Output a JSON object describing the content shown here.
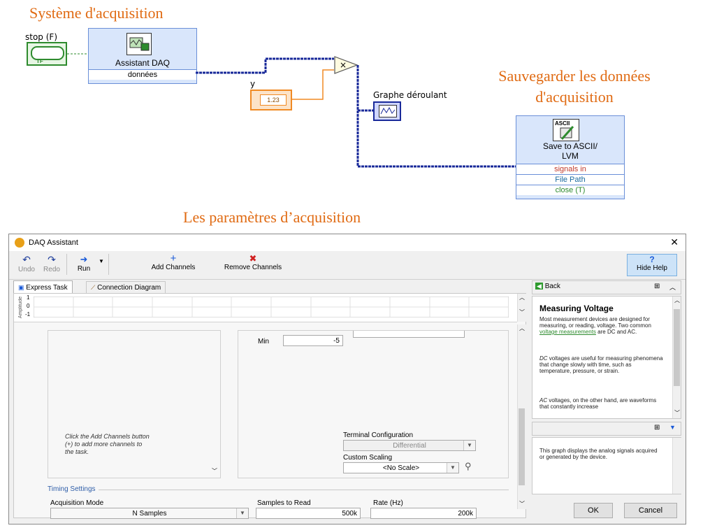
{
  "block_diagram": {
    "heading_acquisition": "Système d'acquisition",
    "heading_save": "Sauvegarder les données\nd'acquisition",
    "heading_params": "Les paramètres d’acquisition",
    "stop_label": "stop (F)",
    "stop_terminal_text": "TF",
    "daq_title": "Assistant DAQ",
    "daq_output": "données",
    "y_label": "y",
    "y_terminal_text": "1.23",
    "graph_label": "Graphe déroulant",
    "save_icon_text": "ASCII",
    "save_title": "Save to ASCII/\nLVM",
    "save_inputs": [
      "signals in",
      "File Path",
      "close (T)"
    ]
  },
  "dialog": {
    "title": "DAQ Assistant",
    "close_glyph": "✕",
    "toolbar": {
      "undo": "Undo",
      "redo": "Redo",
      "run": "Run",
      "add_channels": "Add Channels",
      "remove_channels": "Remove Channels",
      "hide_help": "Hide Help"
    },
    "tabs": [
      "Express Task",
      "Connection Diagram"
    ],
    "graph": {
      "ylabel": "Amplitude",
      "ticks": [
        "1",
        "0",
        "-1"
      ]
    },
    "channels_hint": "Click the Add Channels button\n(+) to add more channels to\nthe task.",
    "min_label": "Min",
    "min_value": "-5",
    "terminal_config_label": "Terminal Configuration",
    "terminal_config_value": "Differential",
    "custom_scaling_label": "Custom Scaling",
    "custom_scaling_value": "<No Scale>",
    "timing": {
      "group_label": "Timing Settings",
      "acq_mode_label": "Acquisition Mode",
      "acq_mode_value": "N Samples",
      "samples_label": "Samples to Read",
      "samples_value": "500k",
      "rate_label": "Rate (Hz)",
      "rate_value": "200k"
    },
    "help": {
      "back": "Back",
      "title": "Measuring Voltage",
      "p1_before": "Most measurement devices are designed for measuring, or reading, voltage. Two common ",
      "p1_link": "voltage measurements",
      "p1_after": " are DC and AC.",
      "p2_em": "DC",
      "p2_rest": " voltages are useful for measuring phenomena that change slowly with time, such as temperature, pressure, or strain.",
      "p3_em": "AC",
      "p3_rest": " voltages, on the other hand, are waveforms that constantly increase",
      "graph_help": "This graph displays the analog signals acquired or generated by the device."
    },
    "ok": "OK",
    "cancel": "Cancel"
  },
  "colors": {
    "heading": "#e06a12",
    "wire_dynamic": "#1a2a9a",
    "numeric_orange": "#f08a24",
    "boolean_green": "#2e8b2e",
    "express_blue": "#d9e6fb"
  }
}
